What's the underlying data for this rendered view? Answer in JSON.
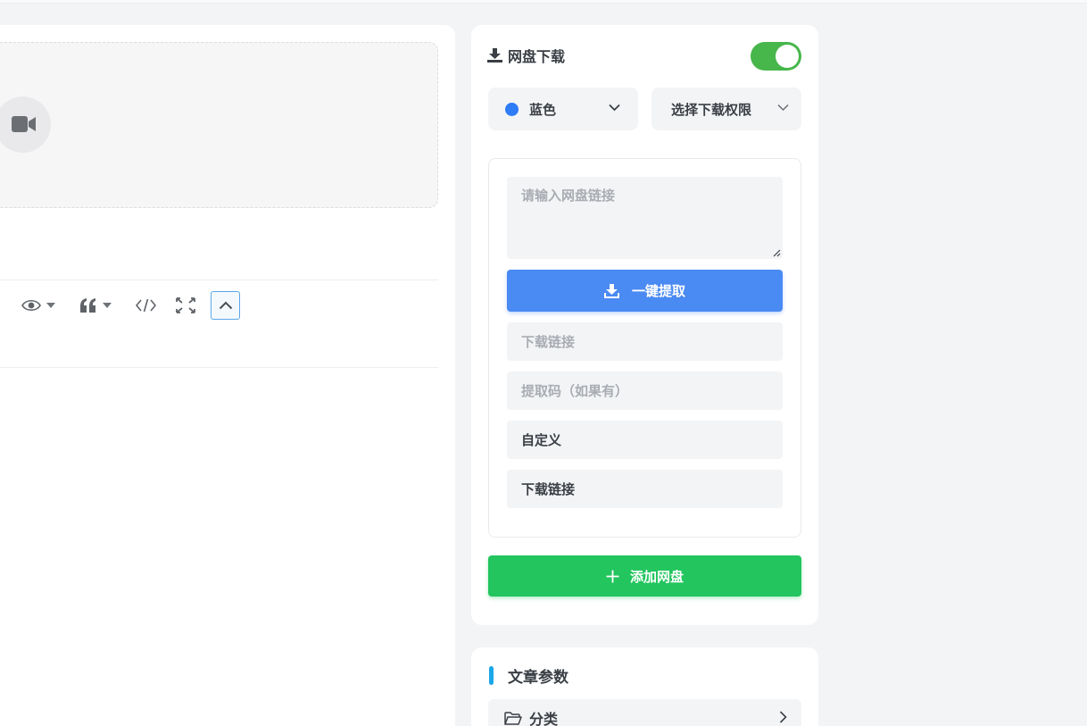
{
  "disk": {
    "title": "网盘下载",
    "enabled": true,
    "color_select": "蓝色",
    "color_value": "#2e7cf6",
    "permission_select": "选择下载权限",
    "link_input_placeholder": "请输入网盘链接",
    "extract_button": "一键提取",
    "download_link_placeholder": "下载链接",
    "extract_code_placeholder": "提取码（如果有）",
    "custom_value": "自定义",
    "download_link_value": "下载链接",
    "add_button": "添加网盘"
  },
  "params": {
    "title": "文章参数",
    "category_label": "分类"
  },
  "colors": {
    "primary_blue": "#4a8af3",
    "success_green": "#22c55e",
    "toggle_green": "#47b64b",
    "accent_cyan": "#1aa7e8"
  }
}
